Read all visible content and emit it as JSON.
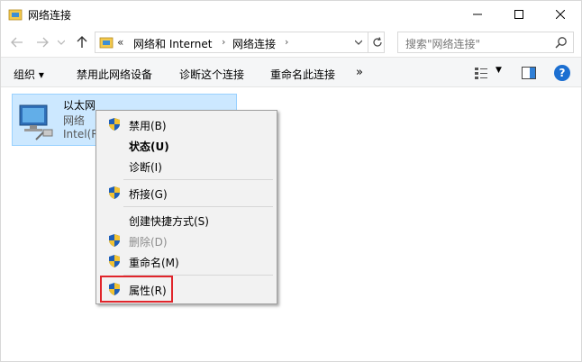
{
  "window": {
    "title": "网络连接",
    "controls": {
      "minimize": "minimize",
      "maximize": "maximize",
      "close": "close"
    }
  },
  "address": {
    "overflow": "«",
    "breadcrumbs": [
      "网络和 Internet",
      "网络连接"
    ],
    "search_placeholder": "搜索\"网络连接\""
  },
  "toolbar": {
    "organize": "组织 ▾",
    "disable": "禁用此网络设备",
    "diagnose": "诊断这个连接",
    "rename": "重命名此连接",
    "more": "»"
  },
  "adapter": {
    "name": "以太网",
    "status": "网络",
    "device": "Intel(R"
  },
  "context_menu": {
    "items": [
      {
        "label": "禁用(B)",
        "shield": true
      },
      {
        "label": "状态(U)",
        "shield": false,
        "bold": true
      },
      {
        "label": "诊断(I)",
        "shield": false
      },
      {
        "label": "桥接(G)",
        "shield": true
      },
      {
        "label": "创建快捷方式(S)",
        "shield": false
      },
      {
        "label": "删除(D)",
        "shield": true,
        "disabled": true
      },
      {
        "label": "重命名(M)",
        "shield": true
      },
      {
        "label": "属性(R)",
        "shield": true,
        "highlighted": true
      }
    ]
  },
  "colors": {
    "selection": "#cce8ff",
    "highlight_box": "#e0252b",
    "help": "#1c6fd1"
  }
}
